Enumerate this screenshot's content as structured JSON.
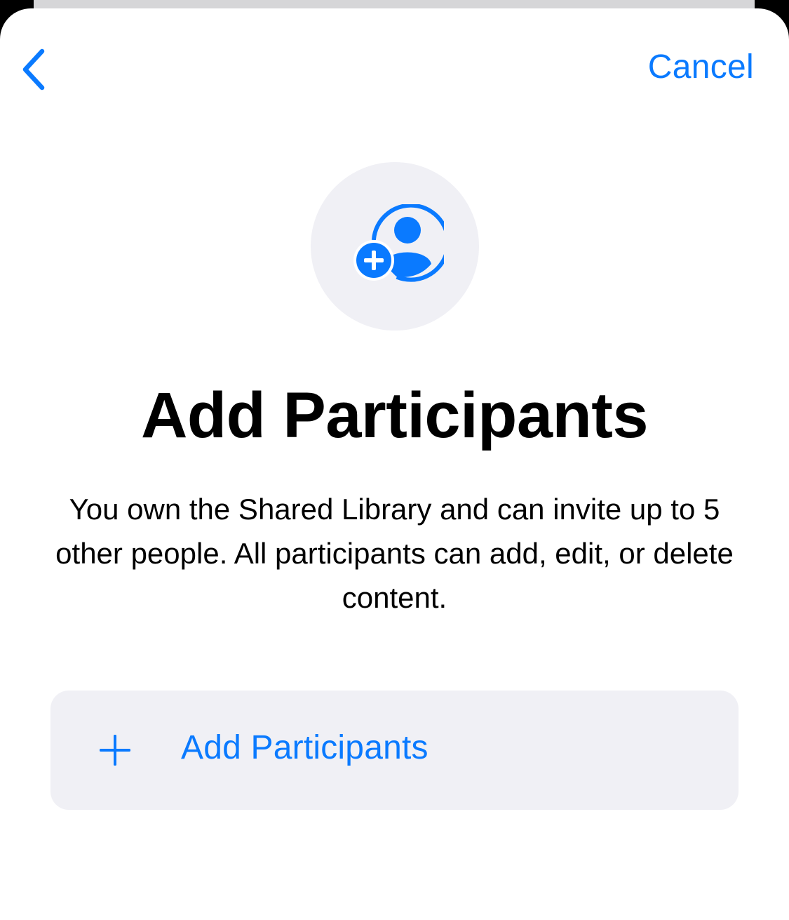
{
  "colors": {
    "accent": "#0a7aff",
    "sheet_background": "#ffffff",
    "secondary_fill": "#f0f0f5",
    "text": "#000000"
  },
  "nav": {
    "back_icon": "chevron-left-icon",
    "cancel_label": "Cancel"
  },
  "hero": {
    "icon": "person-crop-circle-badge-plus-icon"
  },
  "title": "Add Participants",
  "description": "You own the Shared Library and can invite up to 5 other people. All participants can add, edit, or delete content.",
  "add_row": {
    "icon": "plus-icon",
    "label": "Add Participants"
  }
}
